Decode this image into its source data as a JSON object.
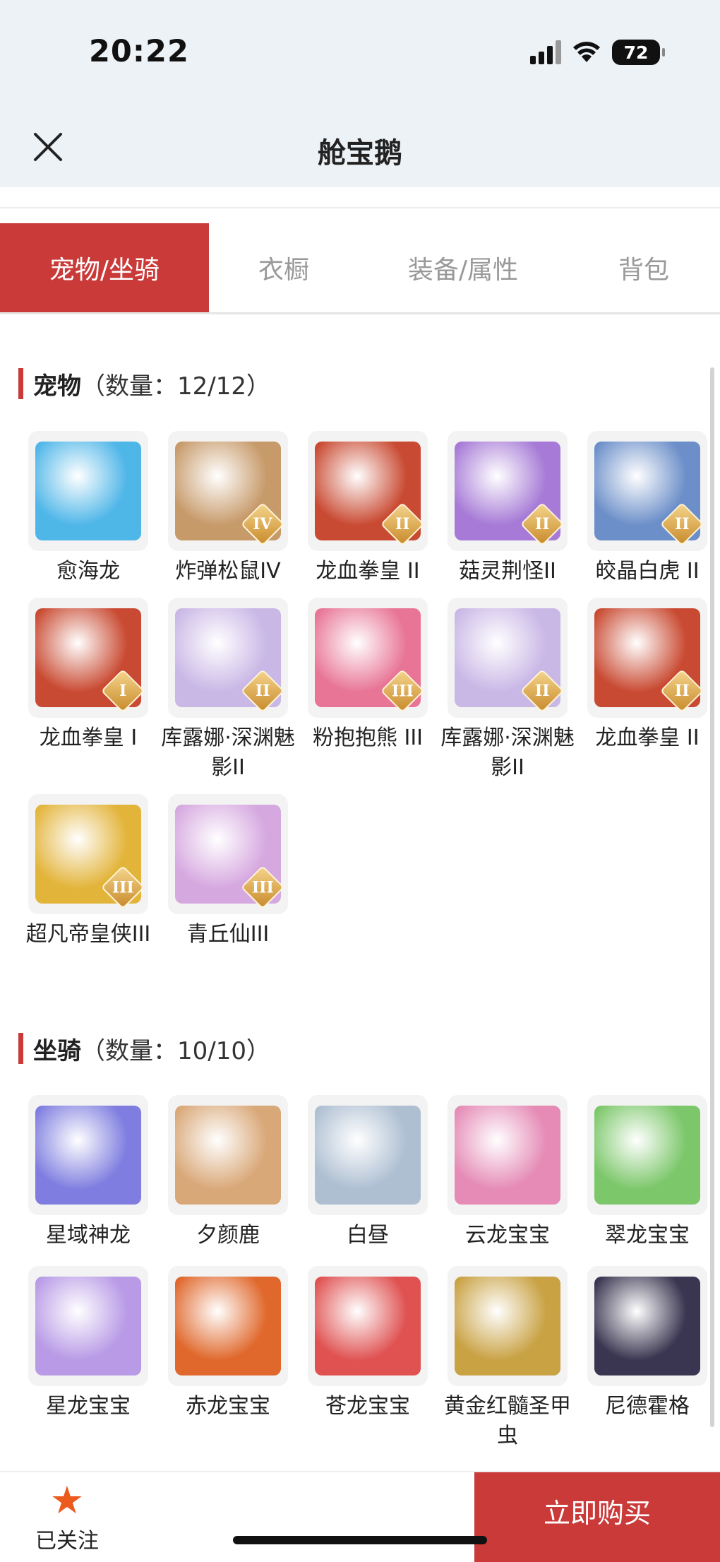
{
  "status": {
    "time": "20:22",
    "battery": "72"
  },
  "header": {
    "title": "舱宝鹅"
  },
  "tabs": [
    {
      "label": "宠物/坐骑",
      "active": true
    },
    {
      "label": "衣橱",
      "active": false
    },
    {
      "label": "装备/属性",
      "active": false
    },
    {
      "label": "背包",
      "active": false
    }
  ],
  "pets": {
    "title": "宠物",
    "count": "（数量：12/12）",
    "items": [
      {
        "name": "愈海龙",
        "badge": "",
        "icon": "water-dragon-icon",
        "color": "#4fb6e8"
      },
      {
        "name": "炸弹松鼠IV",
        "badge": "IV",
        "icon": "squirrel-icon",
        "color": "#c79a6a"
      },
      {
        "name": "龙血拳皇 II",
        "badge": "II",
        "icon": "red-bull-icon",
        "color": "#c94a32"
      },
      {
        "name": "菇灵荆怪II",
        "badge": "II",
        "icon": "mushroom-sprite-icon",
        "color": "#a67ad6"
      },
      {
        "name": "皎晶白虎 II",
        "badge": "II",
        "icon": "white-tiger-icon",
        "color": "#6c8fc9"
      },
      {
        "name": "龙血拳皇 I",
        "badge": "I",
        "icon": "red-bull-icon",
        "color": "#c94a32"
      },
      {
        "name": "库露娜·深渊魅影II",
        "badge": "II",
        "icon": "ghost-girl-icon",
        "color": "#c9b7e6"
      },
      {
        "name": "粉抱抱熊 III",
        "badge": "III",
        "icon": "pink-bear-icon",
        "color": "#e87496"
      },
      {
        "name": "库露娜·深渊魅影II",
        "badge": "II",
        "icon": "ghost-girl-icon",
        "color": "#c9b7e6"
      },
      {
        "name": "龙血拳皇 II",
        "badge": "II",
        "icon": "red-bull-icon",
        "color": "#c94a32"
      },
      {
        "name": "超凡帝皇侠III",
        "badge": "III",
        "icon": "gold-armor-icon",
        "color": "#e3b43a"
      },
      {
        "name": "青丘仙III",
        "badge": "III",
        "icon": "fox-fairy-icon",
        "color": "#d6a8e0"
      }
    ]
  },
  "mounts": {
    "title": "坐骑",
    "count": "（数量：10/10）",
    "items": [
      {
        "name": "星域神龙",
        "icon": "star-dragon-icon",
        "color": "#7f7ee0"
      },
      {
        "name": "夕颜鹿",
        "icon": "deer-icon",
        "color": "#d9a878"
      },
      {
        "name": "白昼",
        "icon": "white-beast-icon",
        "color": "#aebfd2"
      },
      {
        "name": "云龙宝宝",
        "icon": "cloud-dragon-icon",
        "color": "#e58bb6"
      },
      {
        "name": "翠龙宝宝",
        "icon": "green-dragon-icon",
        "color": "#7cc76a"
      },
      {
        "name": "星龙宝宝",
        "icon": "star-baby-dragon-icon",
        "color": "#b89ae6"
      },
      {
        "name": "赤龙宝宝",
        "icon": "red-baby-dragon-icon",
        "color": "#e0682c"
      },
      {
        "name": "苍龙宝宝",
        "icon": "blue-baby-dragon-icon",
        "color": "#e05252"
      },
      {
        "name": "黄金红髓圣甲虫",
        "icon": "golden-beetle-icon",
        "color": "#c9a244"
      },
      {
        "name": "尼德霍格",
        "icon": "dark-dragon-icon",
        "color": "#3a3550"
      }
    ]
  },
  "footer": {
    "follow_label": "已关注",
    "buy_label": "立即购买"
  },
  "colors": {
    "accent": "#c93a39",
    "follow_star": "#ec5a1e"
  }
}
